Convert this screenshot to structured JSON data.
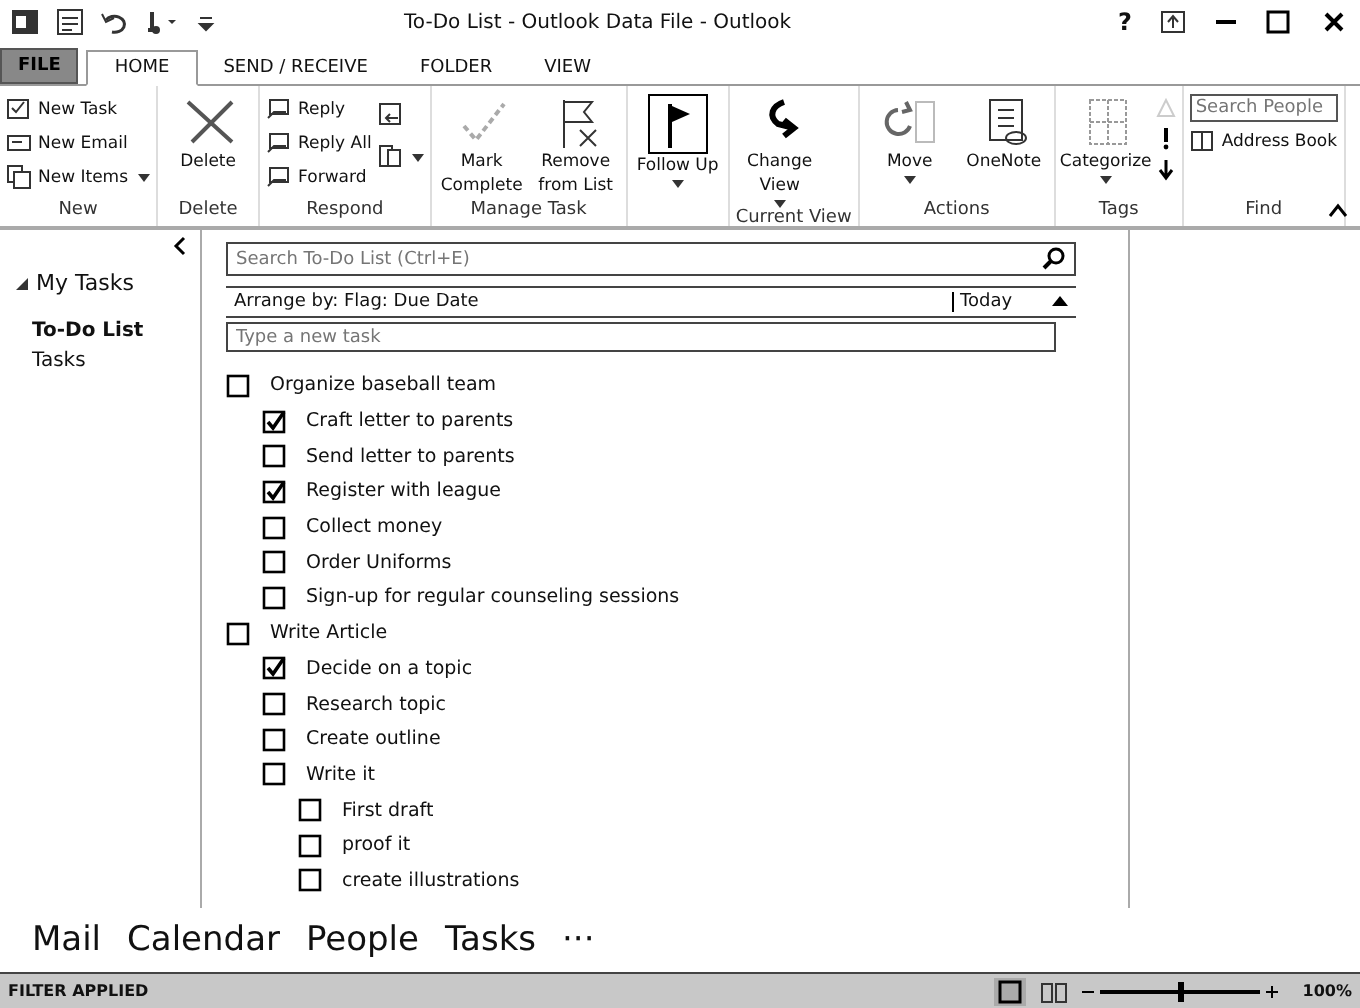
{
  "window": {
    "title": "To-Do List - Outlook Data File - Outlook",
    "help": "?"
  },
  "file_tab": {
    "label": "FILE"
  },
  "tabs": [
    {
      "label": "HOME",
      "selected": true
    },
    {
      "label": "SEND / RECEIVE",
      "selected": false
    },
    {
      "label": "FOLDER",
      "selected": false
    },
    {
      "label": "VIEW",
      "selected": false
    }
  ],
  "ribbon": [
    {
      "label": "New",
      "buttons": [
        {
          "kind": "small",
          "label": "New Task"
        },
        {
          "kind": "small",
          "label": "New Email"
        },
        {
          "kind": "small",
          "label": "New Items",
          "dropdown": true
        }
      ]
    },
    {
      "label": "Delete",
      "buttons": [
        {
          "kind": "large",
          "label": "Delete"
        }
      ]
    },
    {
      "label": "Respond",
      "buttons": [
        {
          "kind": "small",
          "label": "Reply"
        },
        {
          "kind": "small",
          "label": "Reply All"
        },
        {
          "kind": "small",
          "label": "Forward"
        },
        {
          "kind": "mini"
        },
        {
          "kind": "mini",
          "dropdown": true
        }
      ]
    },
    {
      "label": "Manage Task",
      "buttons": [
        {
          "kind": "large",
          "label": "Mark Complete"
        },
        {
          "kind": "large",
          "label": "Remove from List"
        }
      ]
    },
    {
      "buttons": [
        {
          "kind": "large",
          "label": "Follow Up",
          "dropdown": true
        }
      ]
    },
    {
      "label": "Current View",
      "buttons": [
        {
          "kind": "large",
          "label": "Change View",
          "dropdown": true
        }
      ]
    },
    {
      "label": "Actions",
      "buttons": [
        {
          "kind": "large",
          "label": "Move",
          "dropdown": true
        },
        {
          "kind": "large",
          "label": "OneNote"
        }
      ]
    },
    {
      "label": "Tags",
      "buttons": [
        {
          "kind": "large",
          "label": "Categorize",
          "dropdown": true
        },
        {
          "kind": "tags"
        }
      ]
    },
    {
      "label": "Find",
      "buttons": [
        {
          "kind": "search",
          "placeholder": "Search People"
        },
        {
          "kind": "small",
          "label": "Address Book"
        }
      ]
    }
  ],
  "nav": {
    "header": "My Tasks",
    "expanded": true,
    "items": [
      {
        "label": "To-Do List",
        "selected": true
      },
      {
        "label": "Tasks",
        "selected": false
      }
    ]
  },
  "search": {
    "placeholder": "Search To-Do List (Ctrl+E)"
  },
  "arrange": {
    "label": "Arrange by: Flag: Due Date",
    "column": "Today"
  },
  "new_task": {
    "placeholder": "Type a new task"
  },
  "tasks": [
    {
      "label": "Organize baseball team",
      "checked": false,
      "children": [
        {
          "label": "Craft letter to parents",
          "checked": true
        },
        {
          "label": "Send letter to parents",
          "checked": false
        },
        {
          "label": "Register with league",
          "checked": true
        },
        {
          "label": "Collect money",
          "checked": false
        },
        {
          "label": "Order Uniforms",
          "checked": false
        },
        {
          "label": "Sign-up for regular counseling sessions",
          "checked": false
        }
      ]
    },
    {
      "label": "Write Article",
      "checked": false,
      "children": [
        {
          "label": "Decide on a topic",
          "checked": true
        },
        {
          "label": "Research topic",
          "checked": false
        },
        {
          "label": "Create outline",
          "checked": false
        },
        {
          "label": "Write it",
          "checked": false,
          "children": [
            {
              "label": "First draft",
              "checked": false
            },
            {
              "label": "proof it",
              "checked": false
            },
            {
              "label": "create illustrations",
              "checked": false
            }
          ]
        }
      ]
    }
  ],
  "modules": [
    "Mail",
    "Calendar",
    "People",
    "Tasks",
    "···"
  ],
  "status_bar": {
    "filter": "FILTER APPLIED",
    "zoom": {
      "level": 0.5,
      "reading": "100%"
    }
  }
}
